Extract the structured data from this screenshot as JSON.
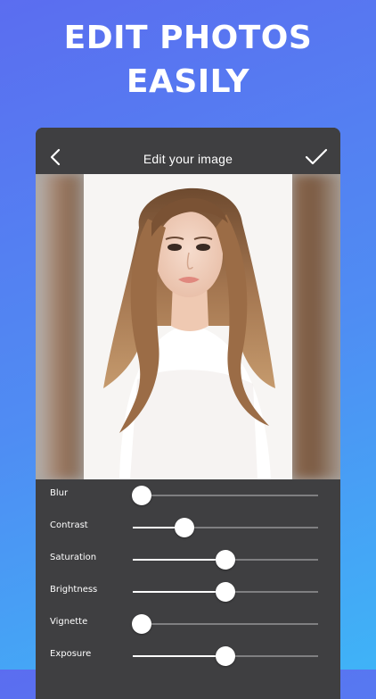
{
  "headline": {
    "line1": "EDIT PHOTOS",
    "line2": "EASILY"
  },
  "editor": {
    "title": "Edit your image",
    "back_icon": "chevron-left-icon",
    "confirm_icon": "checkmark-icon"
  },
  "sliders": [
    {
      "label": "Blur",
      "value": 0.05
    },
    {
      "label": "Contrast",
      "value": 0.28
    },
    {
      "label": "Saturation",
      "value": 0.5
    },
    {
      "label": "Brightness",
      "value": 0.5
    },
    {
      "label": "Vignette",
      "value": 0.05
    },
    {
      "label": "Exposure",
      "value": 0.5
    }
  ],
  "colors": {
    "background_start": "#5b6df0",
    "background_end": "#3fb3f7",
    "panel": "#3f3f41",
    "track": "#7f7f81",
    "thumb": "#ffffff"
  }
}
